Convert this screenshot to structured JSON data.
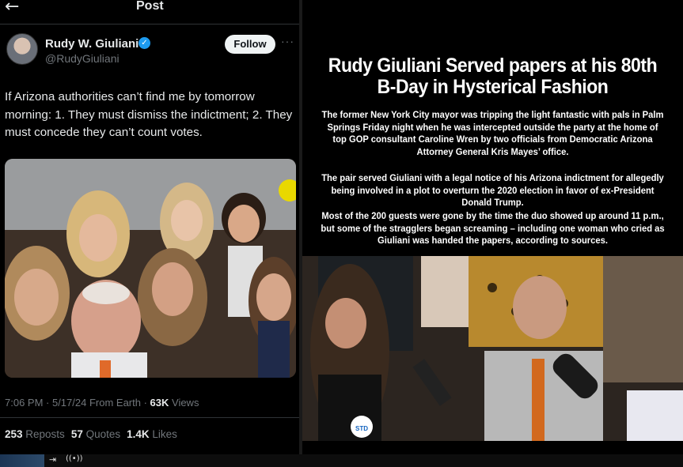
{
  "post": {
    "back_icon": "arrow-left-icon",
    "title": "Post",
    "author": {
      "name": "Rudy W. Giuliani",
      "handle": "@RudyGiuliani",
      "verified_icon": "verified-badge-icon"
    },
    "follow_label": "Follow",
    "more_icon": "more-dots-icon",
    "more_glyph": "···",
    "text": "If Arizona authorities can’t find me by tomorrow morning: 1. They must dismiss the indictment; 2. They must concede they can’t count votes.",
    "meta": {
      "time": "7:06 PM · 5/17/24 From Earth · ",
      "views_count": "63K",
      "views_label": " Views"
    },
    "stats": {
      "reposts_count": "253",
      "reposts_label": " Reposts",
      "quotes_count": "57",
      "quotes_label": " Quotes",
      "likes_count": "1.4K",
      "likes_label": " Likes"
    }
  },
  "article": {
    "headline": "Rudy Giuliani Served papers at his 80th B-Day in Hysterical Fashion",
    "paragraphs": [
      "The former New York City mayor was tripping the light fantastic with pals in Palm Springs Friday night when he was intercepted outside the party at the home of top GOP consultant Caroline Wren by two officials from Democratic Arizona Attorney General Kris Mayes’ office.",
      "The pair served Giuliani with a legal notice of his Arizona indictment for allegedly being involved in a plot to overturn the 2020 election in favor of ex-President Donald Trump.",
      "Most of the 200 guests were gone by the time the duo showed up around 11 p.m., but some of the stragglers began screaming – including one woman who cried as Giuliani was handed the papers, according to sources."
    ],
    "video_logo": "STD"
  },
  "colors": {
    "accent": "#1d9bf0",
    "background": "#000000",
    "muted": "#71767b",
    "text": "#e7e9ea"
  }
}
